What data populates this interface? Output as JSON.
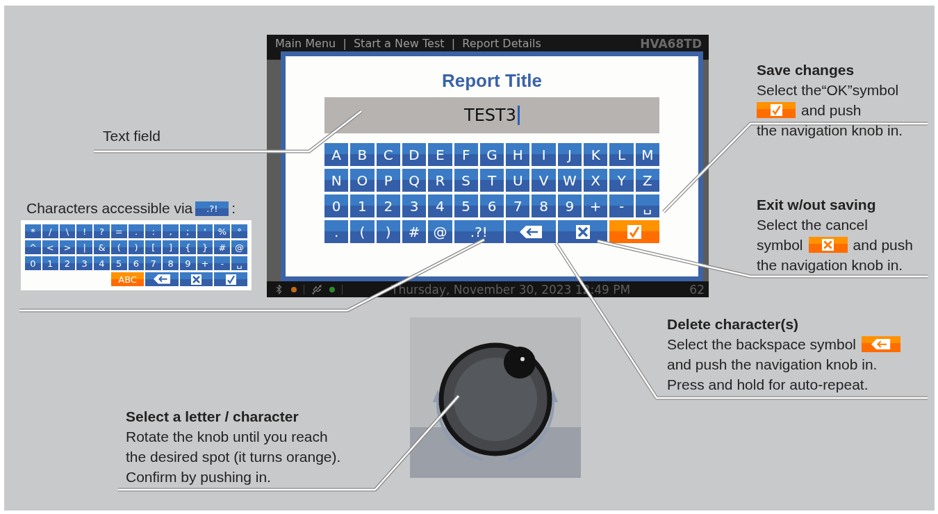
{
  "screen": {
    "breadcrumb": "Main Menu  |  Start a New Test  |  Report Details",
    "model": "HVA68TD",
    "dialog": {
      "title": "Report Title",
      "field_value": "TEST3",
      "keyboard": [
        [
          {
            "kind": "char",
            "label": "A",
            "selected": false
          },
          {
            "kind": "char",
            "label": "B",
            "selected": false
          },
          {
            "kind": "char",
            "label": "C",
            "selected": false
          },
          {
            "kind": "char",
            "label": "D",
            "selected": false
          },
          {
            "kind": "char",
            "label": "E",
            "selected": false
          },
          {
            "kind": "char",
            "label": "F",
            "selected": false
          },
          {
            "kind": "char",
            "label": "G",
            "selected": false
          },
          {
            "kind": "char",
            "label": "H",
            "selected": false
          },
          {
            "kind": "char",
            "label": "I",
            "selected": false
          },
          {
            "kind": "char",
            "label": "J",
            "selected": false
          },
          {
            "kind": "char",
            "label": "K",
            "selected": false
          },
          {
            "kind": "char",
            "label": "L",
            "selected": false
          },
          {
            "kind": "char",
            "label": "M",
            "selected": false
          }
        ],
        [
          {
            "kind": "char",
            "label": "N",
            "selected": false
          },
          {
            "kind": "char",
            "label": "O",
            "selected": false
          },
          {
            "kind": "char",
            "label": "P",
            "selected": false
          },
          {
            "kind": "char",
            "label": "Q",
            "selected": false
          },
          {
            "kind": "char",
            "label": "R",
            "selected": false
          },
          {
            "kind": "char",
            "label": "S",
            "selected": false
          },
          {
            "kind": "char",
            "label": "T",
            "selected": false
          },
          {
            "kind": "char",
            "label": "U",
            "selected": false
          },
          {
            "kind": "char",
            "label": "V",
            "selected": false
          },
          {
            "kind": "char",
            "label": "W",
            "selected": false
          },
          {
            "kind": "char",
            "label": "X",
            "selected": false
          },
          {
            "kind": "char",
            "label": "Y",
            "selected": false
          },
          {
            "kind": "char",
            "label": "Z",
            "selected": false
          }
        ],
        [
          {
            "kind": "char",
            "label": "0",
            "selected": false
          },
          {
            "kind": "char",
            "label": "1",
            "selected": false
          },
          {
            "kind": "char",
            "label": "2",
            "selected": false
          },
          {
            "kind": "char",
            "label": "3",
            "selected": false
          },
          {
            "kind": "char",
            "label": "4",
            "selected": false
          },
          {
            "kind": "char",
            "label": "5",
            "selected": false
          },
          {
            "kind": "char",
            "label": "6",
            "selected": false
          },
          {
            "kind": "char",
            "label": "7",
            "selected": false
          },
          {
            "kind": "char",
            "label": "8",
            "selected": false
          },
          {
            "kind": "char",
            "label": "9",
            "selected": false
          },
          {
            "kind": "char",
            "label": "+",
            "selected": false
          },
          {
            "kind": "char",
            "label": "-",
            "selected": false
          },
          {
            "kind": "char",
            "label": "␣",
            "selected": false
          }
        ],
        [
          {
            "kind": "char",
            "label": ".",
            "selected": false
          },
          {
            "kind": "char",
            "label": "(",
            "selected": false
          },
          {
            "kind": "char",
            "label": ")",
            "selected": false
          },
          {
            "kind": "char",
            "label": "#",
            "selected": false
          },
          {
            "kind": "char",
            "label": "@",
            "selected": false
          },
          {
            "kind": "wide-char",
            "label": ".?!",
            "selected": false
          },
          {
            "kind": "backspace",
            "selected": false
          },
          {
            "kind": "cancel",
            "selected": false
          },
          {
            "kind": "ok",
            "selected": true
          }
        ]
      ]
    },
    "status_bar": {
      "datetime": "Thursday, November 30, 2023 12:49 PM",
      "battery": "62"
    }
  },
  "text_field_callout": {
    "label": "Text field"
  },
  "symbols_callout": {
    "caption": "Characters accessible via",
    "key_label": ".?!",
    "caption_end": ":",
    "keyboard": [
      [
        {
          "kind": "char",
          "label": "*",
          "selected": false
        },
        {
          "kind": "char",
          "label": "/",
          "selected": false
        },
        {
          "kind": "char",
          "label": "\\",
          "selected": false
        },
        {
          "kind": "char",
          "label": "!",
          "selected": false
        },
        {
          "kind": "char",
          "label": "?",
          "selected": false
        },
        {
          "kind": "char",
          "label": "=",
          "selected": false
        },
        {
          "kind": "char",
          "label": ".",
          "selected": false
        },
        {
          "kind": "char",
          "label": ":",
          "selected": false
        },
        {
          "kind": "char",
          "label": ",",
          "selected": false
        },
        {
          "kind": "char",
          "label": ";",
          "selected": false
        },
        {
          "kind": "char",
          "label": "'",
          "selected": false
        },
        {
          "kind": "char",
          "label": "%",
          "selected": false
        },
        {
          "kind": "char",
          "label": "°",
          "selected": false
        }
      ],
      [
        {
          "kind": "char",
          "label": "^",
          "selected": false
        },
        {
          "kind": "char",
          "label": "<",
          "selected": false
        },
        {
          "kind": "char",
          "label": ">",
          "selected": false
        },
        {
          "kind": "char",
          "label": "|",
          "selected": false
        },
        {
          "kind": "char",
          "label": "&",
          "selected": false
        },
        {
          "kind": "char",
          "label": "(",
          "selected": false
        },
        {
          "kind": "char",
          "label": ")",
          "selected": false
        },
        {
          "kind": "char",
          "label": "[",
          "selected": false
        },
        {
          "kind": "char",
          "label": "]",
          "selected": false
        },
        {
          "kind": "char",
          "label": "{",
          "selected": false
        },
        {
          "kind": "char",
          "label": "}",
          "selected": false
        },
        {
          "kind": "char",
          "label": "#",
          "selected": false
        },
        {
          "kind": "char",
          "label": "@",
          "selected": false
        }
      ],
      [
        {
          "kind": "char",
          "label": "0",
          "selected": false
        },
        {
          "kind": "char",
          "label": "1",
          "selected": false
        },
        {
          "kind": "char",
          "label": "2",
          "selected": false
        },
        {
          "kind": "char",
          "label": "3",
          "selected": false
        },
        {
          "kind": "char",
          "label": "4",
          "selected": false
        },
        {
          "kind": "char",
          "label": "5",
          "selected": false
        },
        {
          "kind": "char",
          "label": "6",
          "selected": false
        },
        {
          "kind": "char",
          "label": "7",
          "selected": false
        },
        {
          "kind": "char",
          "label": "8",
          "selected": false
        },
        {
          "kind": "char",
          "label": "9",
          "selected": false
        },
        {
          "kind": "char",
          "label": "+",
          "selected": false
        },
        {
          "kind": "char",
          "label": "-",
          "selected": false
        },
        {
          "kind": "char",
          "label": "␣",
          "selected": false
        }
      ],
      [
        {
          "kind": "wide-char",
          "label": "ABC",
          "selected": true
        },
        {
          "kind": "backspace",
          "selected": false
        },
        {
          "kind": "cancel",
          "selected": false
        },
        {
          "kind": "ok",
          "selected": false
        }
      ]
    ]
  },
  "select_callout": {
    "title": "Select a letter / character",
    "lines": [
      [
        {
          "kind": "text",
          "text": "Rotate the knob until you reach"
        }
      ],
      [
        {
          "kind": "text",
          "text": "the desired spot (it turns orange)."
        }
      ],
      [
        {
          "kind": "text",
          "text": "Confirm by pushing in."
        }
      ]
    ]
  },
  "save_callout": {
    "title": "Save changes",
    "lines": [
      [
        {
          "kind": "text",
          "text": "Select the“OK”symbol"
        }
      ],
      [
        {
          "kind": "ok-symbol"
        },
        {
          "kind": "text",
          "text": "and push"
        }
      ],
      [
        {
          "kind": "text",
          "text": "the navigation knob in."
        }
      ]
    ]
  },
  "exit_callout": {
    "title": "Exit w/out saving",
    "lines": [
      [
        {
          "kind": "text",
          "text": "Select the cancel"
        }
      ],
      [
        {
          "kind": "text",
          "text": "symbol"
        },
        {
          "kind": "cancel-symbol"
        },
        {
          "kind": "text",
          "text": "and push"
        }
      ],
      [
        {
          "kind": "text",
          "text": "the navigation knob in."
        }
      ]
    ]
  },
  "delete_callout": {
    "title": "Delete character(s)",
    "lines": [
      [
        {
          "kind": "text",
          "text": "Select the backspace symbol"
        },
        {
          "kind": "backspace-symbol"
        }
      ],
      [
        {
          "kind": "text",
          "text": "and push the navigation knob in."
        }
      ],
      [
        {
          "kind": "text",
          "text": "Press and hold for auto-repeat."
        }
      ]
    ]
  }
}
